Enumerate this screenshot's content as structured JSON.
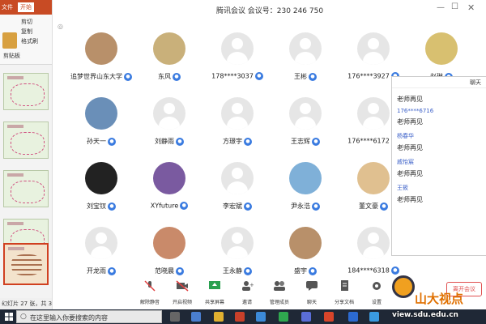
{
  "ppt": {
    "file_tab": "文件",
    "home_tab": "开始",
    "tools": [
      "剪切",
      "复制",
      "格式刷"
    ],
    "clipboard_label": "剪贴板",
    "status": "幻灯片 27 张，共 33 张"
  },
  "meeting": {
    "title": "腾讯会议 会议号：230 246 750",
    "participants": [
      {
        "name": "追梦世界山东大学",
        "avatar": "photo"
      },
      {
        "name": "东风",
        "avatar": "photo"
      },
      {
        "name": "178****3037",
        "avatar": "default"
      },
      {
        "name": "王彬",
        "avatar": "default"
      },
      {
        "name": "176****3927",
        "avatar": "default"
      },
      {
        "name": "赵琳",
        "avatar": "photo"
      },
      {
        "name": "孙天一",
        "avatar": "photo"
      },
      {
        "name": "刘静雨",
        "avatar": "default"
      },
      {
        "name": "方璟宇",
        "avatar": "default"
      },
      {
        "name": "王志辉",
        "avatar": "default"
      },
      {
        "name": "176****6172",
        "avatar": "default"
      },
      {
        "name": "刘宝钗",
        "avatar": "photo"
      },
      {
        "name": "XYfuture",
        "avatar": "photo"
      },
      {
        "name": "李宏斌",
        "avatar": "default"
      },
      {
        "name": "尹永浩",
        "avatar": "photo"
      },
      {
        "name": "董文豪",
        "avatar": "photo"
      },
      {
        "name": "开龙雨",
        "avatar": "default"
      },
      {
        "name": "范晓晨",
        "avatar": "photo"
      },
      {
        "name": "王永静",
        "avatar": "default"
      },
      {
        "name": "盛宇",
        "avatar": "photo"
      },
      {
        "name": "184****6318",
        "avatar": "default"
      }
    ]
  },
  "chat": {
    "title": "聊天",
    "entries": [
      {
        "sender": "",
        "message": "老师再见"
      },
      {
        "sender": "176****6716",
        "message": "老师再见"
      },
      {
        "sender": "杨春华",
        "message": "老师再见"
      },
      {
        "sender": "戚怡宸",
        "message": "老师再见"
      },
      {
        "sender": "王筱",
        "message": "老师再见"
      }
    ]
  },
  "toolbar": {
    "items": [
      "解除静音",
      "开启视频",
      "共享屏幕",
      "邀请",
      "管理成员",
      "聊天",
      "分享文档",
      "设置"
    ],
    "leave_label": "离开会议"
  },
  "taskbar": {
    "search_placeholder": "在这里输入你要搜索的内容"
  },
  "watermark": {
    "title": "山大视点",
    "url": "view.sdu.edu.cn"
  },
  "colors": {
    "ppt_accent": "#c84b24",
    "mic_badge": "#3a7be0",
    "leave": "#e05050",
    "taskbar": "#1f2836"
  }
}
